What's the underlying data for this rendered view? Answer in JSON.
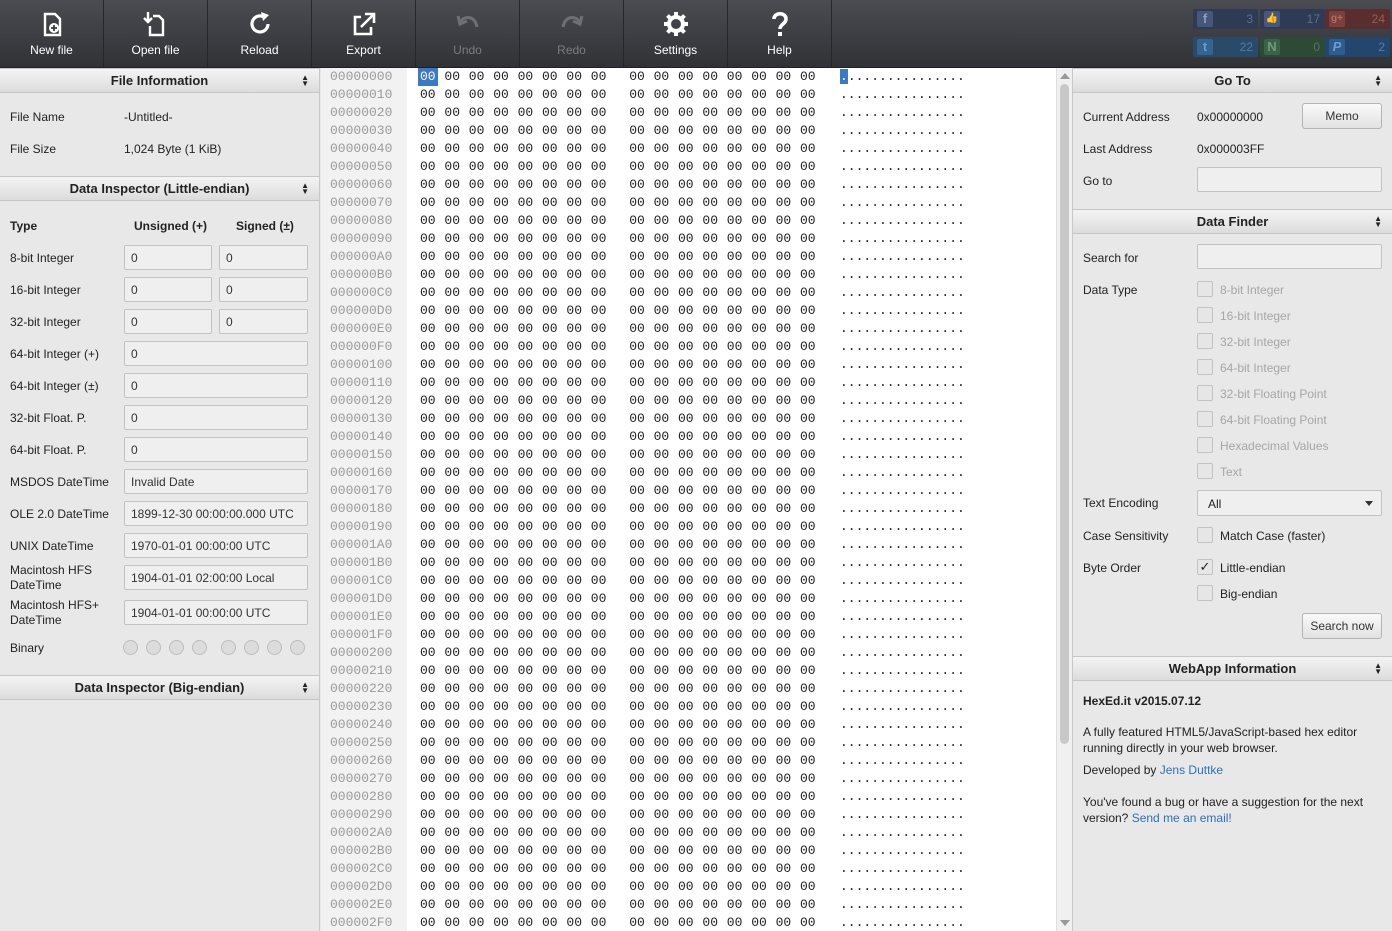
{
  "toolbar": {
    "buttons": [
      {
        "label": "New file",
        "icon": "new-file-icon"
      },
      {
        "label": "Open file",
        "icon": "open-file-icon"
      },
      {
        "label": "Reload",
        "icon": "reload-icon"
      },
      {
        "label": "Export",
        "icon": "export-icon"
      },
      {
        "label": "Undo",
        "icon": "undo-icon",
        "disabled": true
      },
      {
        "label": "Redo",
        "icon": "redo-icon",
        "disabled": true
      },
      {
        "label": "Settings",
        "icon": "gear-icon"
      },
      {
        "label": "Help",
        "icon": "help-icon"
      }
    ],
    "social": [
      {
        "name": "facebook",
        "glyph": "f",
        "count": "3"
      },
      {
        "name": "like",
        "glyph": "👍",
        "count": "17"
      },
      {
        "name": "google-plus",
        "glyph": "g+",
        "count": "24"
      },
      {
        "name": "twitter",
        "glyph": "t",
        "count": "22"
      },
      {
        "name": "n-network",
        "glyph": "N",
        "count": "0"
      },
      {
        "name": "pinterest",
        "glyph": "P",
        "count": "2"
      }
    ]
  },
  "file_info": {
    "title": "File Information",
    "name_label": "File Name",
    "name_value": "-Untitled-",
    "size_label": "File Size",
    "size_value": "1,024 Byte (1 KiB)"
  },
  "inspector_le": {
    "title": "Data Inspector (Little-endian)",
    "col_type": "Type",
    "col_unsigned": "Unsigned (+)",
    "col_signed": "Signed (±)",
    "rows": [
      {
        "label": "8-bit Integer",
        "unsigned": "0",
        "signed": "0"
      },
      {
        "label": "16-bit Integer",
        "unsigned": "0",
        "signed": "0"
      },
      {
        "label": "32-bit Integer",
        "unsigned": "0",
        "signed": "0"
      },
      {
        "label": "64-bit Integer (+)",
        "value": "0"
      },
      {
        "label": "64-bit Integer (±)",
        "value": "0"
      },
      {
        "label": "32-bit Float. P.",
        "value": "0"
      },
      {
        "label": "64-bit Float. P.",
        "value": "0"
      },
      {
        "label": "MSDOS DateTime",
        "value": "Invalid Date"
      },
      {
        "label": "OLE 2.0 DateTime",
        "value": "1899-12-30 00:00:00.000 UTC"
      },
      {
        "label": "UNIX DateTime",
        "value": "1970-01-01 00:00:00 UTC"
      },
      {
        "label": "Macintosh HFS\nDateTime",
        "value": "1904-01-01 02:00:00 Local"
      },
      {
        "label": "Macintosh HFS+\nDateTime",
        "value": "1904-01-01 00:00:00 UTC"
      }
    ],
    "binary_label": "Binary"
  },
  "inspector_be": {
    "title": "Data Inspector (Big-endian)"
  },
  "hex": {
    "offsets": [
      "00000000",
      "00000010",
      "00000020",
      "00000030",
      "00000040",
      "00000050",
      "00000060",
      "00000070",
      "00000080",
      "00000090",
      "000000A0",
      "000000B0",
      "000000C0",
      "000000D0",
      "000000E0",
      "000000F0",
      "00000100",
      "00000110",
      "00000120",
      "00000130",
      "00000140",
      "00000150",
      "00000160",
      "00000170",
      "00000180",
      "00000190",
      "000001A0",
      "000001B0",
      "000001C0",
      "000001D0",
      "000001E0",
      "000001F0",
      "00000200",
      "00000210",
      "00000220",
      "00000230",
      "00000240",
      "00000250",
      "00000260",
      "00000270",
      "00000280",
      "00000290",
      "000002A0",
      "000002B0",
      "000002C0",
      "000002D0",
      "000002E0",
      "000002F0"
    ],
    "byte": "00",
    "ascii": "................"
  },
  "goto": {
    "title": "Go To",
    "current_label": "Current Address",
    "current_value": "0x00000000",
    "memo_label": "Memo",
    "last_label": "Last Address",
    "last_value": "0x000003FF",
    "goto_label": "Go to",
    "goto_value": ""
  },
  "finder": {
    "title": "Data Finder",
    "search_label": "Search for",
    "search_value": "",
    "type_label": "Data Type",
    "types": [
      "8-bit Integer",
      "16-bit Integer",
      "32-bit Integer",
      "64-bit Integer",
      "32-bit Floating Point",
      "64-bit Floating Point",
      "Hexadecimal Values",
      "Text"
    ],
    "encoding_label": "Text Encoding",
    "encoding_value": "All",
    "case_label": "Case Sensitivity",
    "case_option": "Match Case (faster)",
    "order_label": "Byte Order",
    "order_le": "Little-endian",
    "order_be": "Big-endian",
    "check_mark": "✓",
    "search_button": "Search now"
  },
  "webapp": {
    "title": "WebApp Information",
    "version": "HexEd.it v2015.07.12",
    "description": "A fully featured HTML5/JavaScript-based hex editor running directly in your web browser.",
    "developed_by": "Developed by",
    "author": "Jens Duttke",
    "bug_text": "You've found a bug or have a suggestion for the next version?",
    "email_link": "Send me an email!"
  },
  "colors": {
    "toolbar": "#3b3d41",
    "selection": "#3a78c8",
    "link": "#2a73b5"
  }
}
